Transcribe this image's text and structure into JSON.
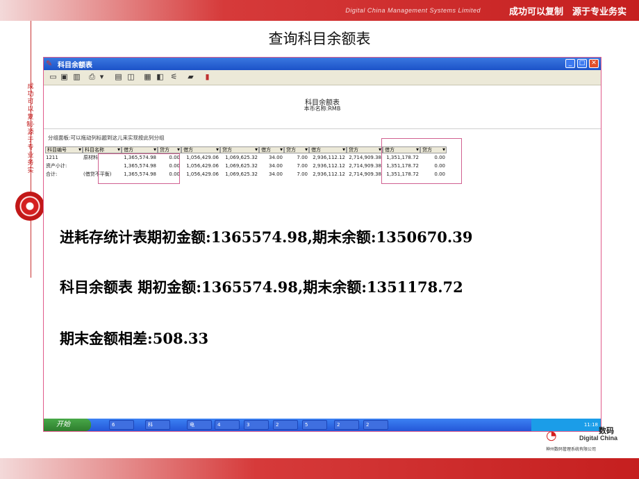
{
  "slide": {
    "header_company": "Digital China Management Systems Limited",
    "header_tagline": "成功可以复制　源于专业务实",
    "title": "查询科目余额表",
    "left_vertical_text": "成功可以复制·源于专业务实"
  },
  "window": {
    "title": "科目余额表",
    "buttons": {
      "minimize": "_",
      "maximize": "□",
      "close": "✕"
    }
  },
  "toolbar": {
    "icons": [
      "open-icon",
      "save-icon",
      "delete-icon",
      "preview-icon",
      "print-icon",
      "refresh-icon",
      "filter-icon",
      "export-icon",
      "settings-icon",
      "chart-icon",
      "exit-icon"
    ]
  },
  "report": {
    "title": "科目余额表",
    "currency_line": "本币名称:RMB",
    "group_hint": "分组面板:可以拖动列标题到这儿来实现按此列分组"
  },
  "grid": {
    "headers": [
      "科目编号",
      "科目名称",
      "借方",
      "贷方",
      "借方",
      "贷方",
      "借方",
      "贷方",
      "借方",
      "贷方",
      "借方",
      "贷方"
    ],
    "rows": [
      [
        "1211",
        "原材料",
        "1,365,574.98",
        "0.00",
        "1,056,429.06",
        "1,069,625.32",
        "34.00",
        "7.00",
        "2,936,112.12",
        "2,714,909.38",
        "1,351,178.72",
        "0.00"
      ],
      [
        "资产小计:",
        "",
        "1,365,574.98",
        "0.00",
        "1,056,429.06",
        "1,069,625.32",
        "34.00",
        "7.00",
        "2,936,112.12",
        "2,714,909.38",
        "1,351,178.72",
        "0.00"
      ],
      [
        "合计:",
        "(借贷不平衡)",
        "1,365,574.98",
        "0.00",
        "1,056,429.06",
        "1,069,625.32",
        "34.00",
        "7.00",
        "2,936,112.12",
        "2,714,909.38",
        "1,351,178.72",
        "0.00"
      ]
    ]
  },
  "notes": {
    "line1": "进耗存统计表期初金额:1365574.98,期末余额:1350670.39",
    "line2": "科目余额表  期初金额:1365574.98,期末余额:1351178.72",
    "line3": "期末金额相差:508.33"
  },
  "taskbar": {
    "start_label": "开始",
    "items": [
      "6",
      "科",
      "电",
      "4",
      "3",
      "2",
      "5",
      "2",
      "2"
    ],
    "clock": "11:18"
  },
  "logo": {
    "cn": "数码",
    "en": "Digital China",
    "sub": "神州数码管理系统有限公司"
  },
  "colors": {
    "accent_red": "#c51f1f",
    "highlight_pink": "#d06090",
    "xp_blue": "#2457d8"
  }
}
